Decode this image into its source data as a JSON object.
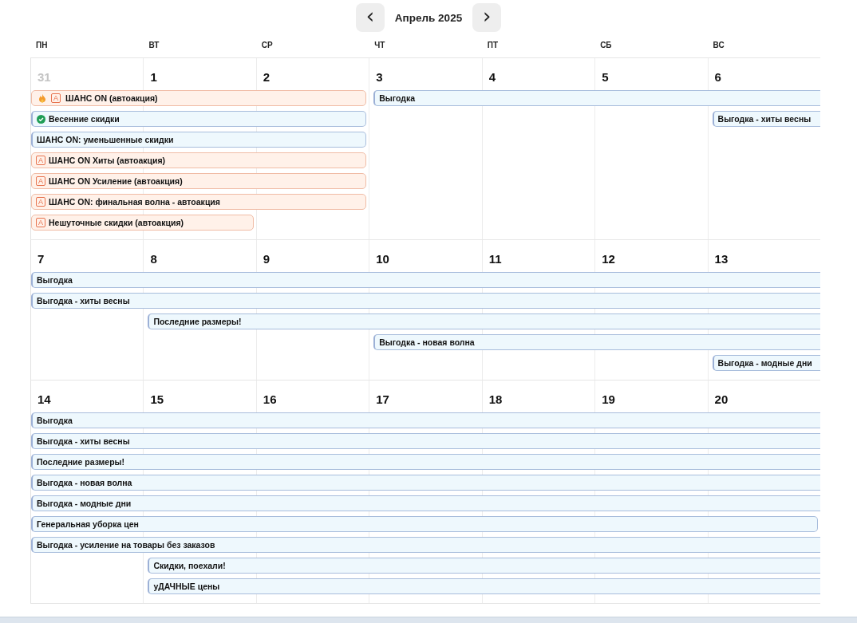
{
  "header": {
    "prev": "‹",
    "title": "Апрель 2025",
    "next": "›"
  },
  "weekdays": [
    "ПН",
    "ВТ",
    "СР",
    "ЧТ",
    "ПТ",
    "СБ",
    "ВС"
  ],
  "weeks": [
    {
      "days": [
        {
          "number": "31",
          "other_month": true
        },
        {
          "number": "1",
          "other_month": false
        },
        {
          "number": "2",
          "other_month": false
        },
        {
          "number": "3",
          "other_month": false
        },
        {
          "number": "4",
          "other_month": false
        },
        {
          "number": "5",
          "other_month": false
        },
        {
          "number": "6",
          "other_month": false
        }
      ],
      "events": [
        {
          "title": "ШАНС ON (автоакция)",
          "kind": "auto",
          "badge": "A",
          "hot": true,
          "confirmed": false
        },
        {
          "title": "Выгодка",
          "kind": "promo",
          "hot": false,
          "confirmed": false
        },
        {
          "title": "Весенние скидки",
          "kind": "promo",
          "hot": false,
          "confirmed": true
        },
        {
          "title": "Выгодка - хиты весны",
          "kind": "promo",
          "hot": false,
          "confirmed": false
        },
        {
          "title": "ШАНС ON: уменьшенные скидки",
          "kind": "promo",
          "hot": false,
          "confirmed": false
        },
        {
          "title": "ШАНС ON Хиты (автоакция)",
          "kind": "auto",
          "badge": "A",
          "hot": false,
          "confirmed": false
        },
        {
          "title": "ШАНС ON Усиление (автоакция)",
          "kind": "auto",
          "badge": "A",
          "hot": false,
          "confirmed": false
        },
        {
          "title": "ШАНС ON: финальная волна - автоакция",
          "kind": "auto",
          "badge": "A",
          "hot": false,
          "confirmed": false
        },
        {
          "title": "Нешуточные скидки (автоакция)",
          "kind": "auto",
          "badge": "A",
          "hot": false,
          "confirmed": false
        }
      ]
    },
    {
      "days": [
        {
          "number": "7",
          "other_month": false
        },
        {
          "number": "8",
          "other_month": false
        },
        {
          "number": "9",
          "other_month": false
        },
        {
          "number": "10",
          "other_month": false
        },
        {
          "number": "11",
          "other_month": false
        },
        {
          "number": "12",
          "other_month": false
        },
        {
          "number": "13",
          "other_month": false
        }
      ],
      "events": [
        {
          "title": "Выгодка",
          "kind": "promo",
          "hot": false,
          "confirmed": false
        },
        {
          "title": "Выгодка - хиты весны",
          "kind": "promo",
          "hot": false,
          "confirmed": false
        },
        {
          "title": "Последние размеры!",
          "kind": "promo",
          "hot": false,
          "confirmed": false
        },
        {
          "title": "Выгодка - новая волна",
          "kind": "promo",
          "hot": false,
          "confirmed": false
        },
        {
          "title": "Выгодка - модные дни",
          "kind": "promo",
          "hot": false,
          "confirmed": false
        }
      ]
    },
    {
      "days": [
        {
          "number": "14",
          "other_month": false
        },
        {
          "number": "15",
          "other_month": false
        },
        {
          "number": "16",
          "other_month": false
        },
        {
          "number": "17",
          "other_month": false
        },
        {
          "number": "18",
          "other_month": false
        },
        {
          "number": "19",
          "other_month": false
        },
        {
          "number": "20",
          "other_month": false
        }
      ],
      "events": [
        {
          "title": "Выгодка",
          "kind": "promo",
          "hot": false,
          "confirmed": false
        },
        {
          "title": "Выгодка - хиты весны",
          "kind": "promo",
          "hot": false,
          "confirmed": false
        },
        {
          "title": "Последние размеры!",
          "kind": "promo",
          "hot": false,
          "confirmed": false
        },
        {
          "title": "Выгодка - новая волна",
          "kind": "promo",
          "hot": false,
          "confirmed": false
        },
        {
          "title": "Выгодка - модные дни",
          "kind": "promo",
          "hot": false,
          "confirmed": false
        },
        {
          "title": "Генеральная уборка цен",
          "kind": "promo",
          "hot": false,
          "confirmed": false
        },
        {
          "title": "Выгодка - усиление на товары без заказов",
          "kind": "promo",
          "hot": false,
          "confirmed": false
        },
        {
          "title": "Скидки, поехали!",
          "kind": "promo",
          "hot": false,
          "confirmed": false
        },
        {
          "title": "уДАЧНЫЕ цены",
          "kind": "promo",
          "hot": false,
          "confirmed": false
        }
      ]
    }
  ]
}
